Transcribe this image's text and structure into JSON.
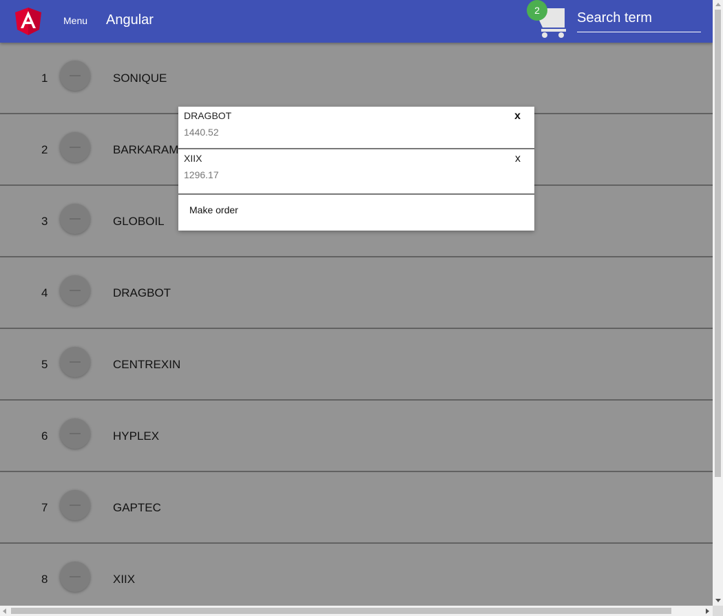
{
  "toolbar": {
    "logo_icon": "angular-logo-icon",
    "menu_label": "Menu",
    "title": "Angular",
    "cart_icon": "shopping-cart-icon",
    "cart_count": "2",
    "search_placeholder": "Search term",
    "colors": {
      "toolbar": "#3f51b5",
      "badge": "#4caf50",
      "logo": "#dd0031"
    }
  },
  "products": [
    {
      "num": "1",
      "name": "SONIQUE"
    },
    {
      "num": "2",
      "name": "BARKARAMA"
    },
    {
      "num": "3",
      "name": "GLOBOIL"
    },
    {
      "num": "4",
      "name": "DRAGBOT"
    },
    {
      "num": "5",
      "name": "CENTREXIN"
    },
    {
      "num": "6",
      "name": "HYPLEX"
    },
    {
      "num": "7",
      "name": "GAPTEC"
    },
    {
      "num": "8",
      "name": "XIIX"
    }
  ],
  "cart_popup": {
    "items": [
      {
        "name": "DRAGBOT",
        "price": "1440.52",
        "remove_label": "x"
      },
      {
        "name": "XIIX",
        "price": "1296.17",
        "remove_label": "x"
      }
    ],
    "order_label": "Make order"
  }
}
